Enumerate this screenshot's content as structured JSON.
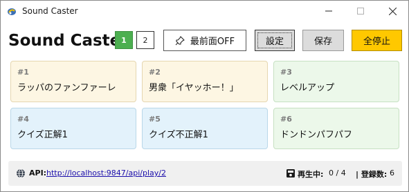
{
  "window": {
    "title": "Sound Caster"
  },
  "header": {
    "app_title": "Sound Caster",
    "pages": [
      {
        "label": "1",
        "active": true
      },
      {
        "label": "2",
        "active": false
      }
    ],
    "pin_button": {
      "label": "最前面OFF",
      "icon": "pin-icon"
    },
    "settings_label": "設定",
    "save_label": "保存",
    "stop_all_label": "全停止",
    "colors": {
      "active_page": "#4caf50",
      "stop_all": "#ffc800"
    }
  },
  "sounds": [
    {
      "number": "#1",
      "label": "ラッパのファンファーレ",
      "color": "yellow"
    },
    {
      "number": "#2",
      "label": "男衆「イヤッホー！」",
      "color": "yellow"
    },
    {
      "number": "#3",
      "label": "レベルアップ",
      "color": "green"
    },
    {
      "number": "#4",
      "label": "クイズ正解1",
      "color": "blue"
    },
    {
      "number": "#5",
      "label": "クイズ不正解1",
      "color": "blue"
    },
    {
      "number": "#6",
      "label": "ドンドンパフパフ",
      "color": "green"
    }
  ],
  "status": {
    "api_label": "API:",
    "api_url": "http://localhost:9847/api/play/2",
    "playing_label": "再生中:",
    "playing_value": "0 / 4",
    "registered_label": "| 登録数:",
    "registered_value": "6"
  }
}
